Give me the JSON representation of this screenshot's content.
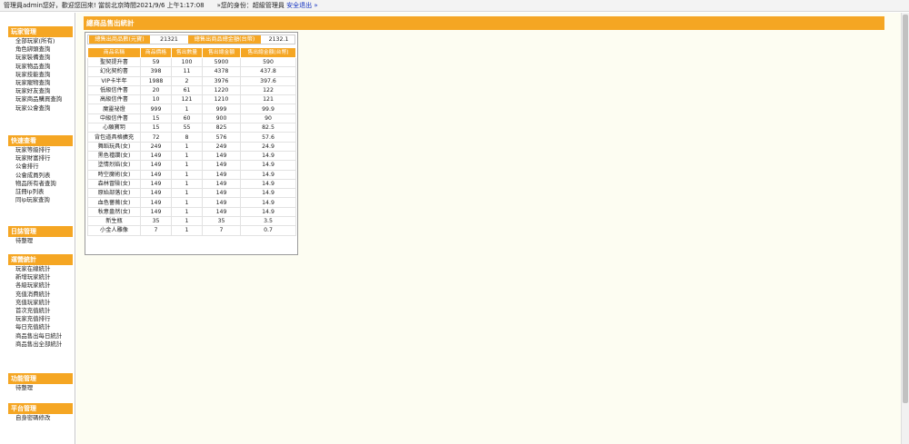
{
  "topbar": {
    "greeting": "管理員admin您好，歡迎您回來! 當前北京時間2021/9/6 上午1:17:08",
    "identity": "»您的身份：超級管理員",
    "logout_label": "安全退出",
    "logout_arrow": "»"
  },
  "sidebar": {
    "groups": [
      {
        "title": "玩家管理",
        "items": [
          "全部玩家(所有)",
          "角色綁頭查詢",
          "玩家裝備查詢",
          "玩家物品查詢",
          "玩家技能查詢",
          "玩家寵物查詢",
          "玩家好友查詢",
          "玩家商品購買查詢",
          "玩家公會查詢"
        ]
      },
      {
        "title": "快速查看",
        "items": [
          "玩家等級排行",
          "玩家財富排行",
          "公會排行",
          "公會成員列表",
          "物品所有者查詢",
          "註冊ip列表",
          "同ip玩家查詢"
        ]
      },
      {
        "title": "日誌管理",
        "items": [
          "待整理"
        ]
      },
      {
        "title": "運營統計",
        "items": [
          "玩家在線統計",
          "新增玩家統計",
          "各級玩家統計",
          "充值消費統計",
          "充值玩家統計",
          "首次充值統計",
          "玩家充值排行",
          "每日充值統計",
          "商品售出每日統計",
          "商品售出全部統計"
        ]
      },
      {
        "title": "功能管理",
        "items": [
          "待整理"
        ]
      },
      {
        "title": "平台管理",
        "items": [
          "自身密碼修改"
        ]
      }
    ]
  },
  "main": {
    "title": "總商品售出統計",
    "summary": {
      "count_label": "總售出商品數(元寶)",
      "count_value": "21321",
      "amount_label": "總售出商品總金額(台幣)",
      "amount_value": "2132.1"
    },
    "table": {
      "headers": [
        "商品名稱",
        "商品價格",
        "售出數量",
        "售出總金額",
        "售出總金額(台幣)"
      ],
      "rows": [
        [
          "聖契提升書",
          "59",
          "100",
          "5900",
          "590"
        ],
        [
          "幻化契約書",
          "398",
          "11",
          "4378",
          "437.8"
        ],
        [
          "VIP卡半年",
          "1988",
          "2",
          "3976",
          "397.6"
        ],
        [
          "低級信件書",
          "20",
          "61",
          "1220",
          "122"
        ],
        [
          "高級信件書",
          "10",
          "121",
          "1210",
          "121"
        ],
        [
          "魔靈祕燈",
          "999",
          "1",
          "999",
          "99.9"
        ],
        [
          "中級信件書",
          "15",
          "60",
          "900",
          "90"
        ],
        [
          "心願寶玥",
          "15",
          "55",
          "825",
          "82.5"
        ],
        [
          "背包道具格擴充",
          "72",
          "8",
          "576",
          "57.6"
        ],
        [
          "舞蹈玩具(女)",
          "249",
          "1",
          "249",
          "24.9"
        ],
        [
          "黑色禮讚(女)",
          "149",
          "1",
          "149",
          "14.9"
        ],
        [
          "塗情烈焰(女)",
          "149",
          "1",
          "149",
          "14.9"
        ],
        [
          "時空魔術(女)",
          "149",
          "1",
          "149",
          "14.9"
        ],
        [
          "森林冒險(女)",
          "149",
          "1",
          "149",
          "14.9"
        ],
        [
          "原始部落(女)",
          "149",
          "1",
          "149",
          "14.9"
        ],
        [
          "血色薔薇(女)",
          "149",
          "1",
          "149",
          "14.9"
        ],
        [
          "秋意盎然(女)",
          "149",
          "1",
          "149",
          "14.9"
        ],
        [
          "新生瓶",
          "35",
          "1",
          "35",
          "3.5"
        ],
        [
          "小金人雕像",
          "7",
          "1",
          "7",
          "0.7"
        ]
      ]
    }
  },
  "colors": {
    "accent": "#f5a623",
    "link": "#1030c0",
    "main_bg": "#fdfdf2"
  }
}
